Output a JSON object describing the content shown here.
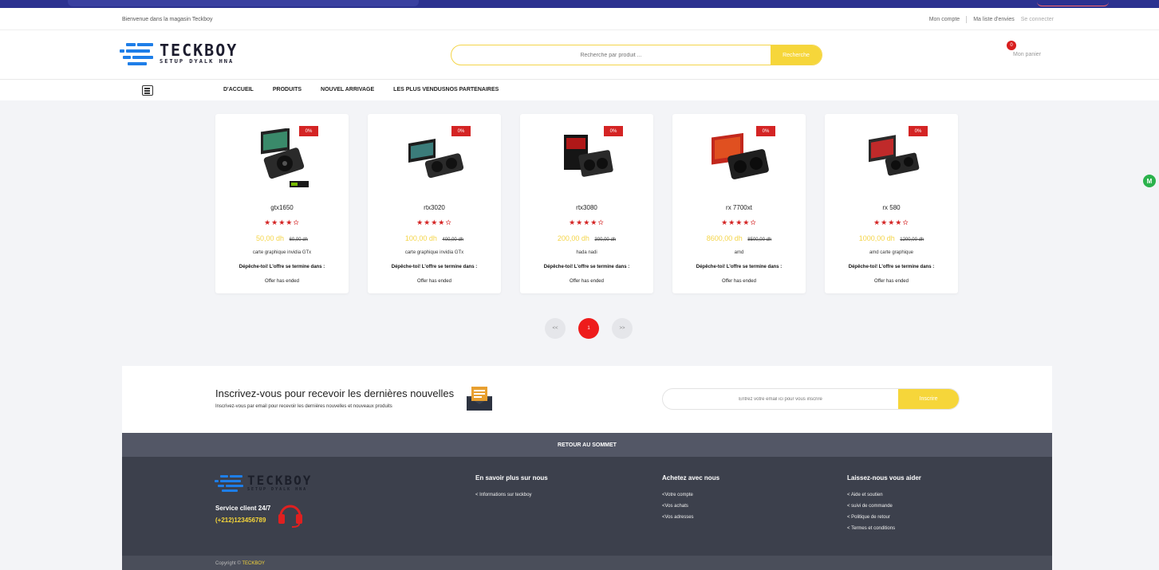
{
  "topbar": {
    "welcome": "Bienvenue dans la magasin Teckboy",
    "account": "Mon compte",
    "wishlist": "Ma liste d'envies",
    "logout": "Se connecter"
  },
  "brand": {
    "name": "TECKBOY",
    "tagline": "SETUP DYALK HNA",
    "accent": "#1e7ee8"
  },
  "search": {
    "placeholder": "Recherche par produit ...",
    "button": "Recherche"
  },
  "cart": {
    "count": "0",
    "label": "Mon panier"
  },
  "nav": {
    "items": [
      "D'ACCUEIL",
      "PRODUITS",
      "NOUVEL ARRIVAGE",
      "LES PLUS VENDUSNOS PARTENAIRES"
    ]
  },
  "products": [
    {
      "discount": "0%",
      "name": "gtx1650",
      "stars": "★★★★✫",
      "price": "50,00 dh",
      "old_price": "60,00 dh",
      "desc": "carte graphique invidia GTx",
      "timer": "Dépêche-toi! L'offre se termine dans :",
      "status": "Offer has ended"
    },
    {
      "discount": "0%",
      "name": "rtx3020",
      "stars": "★★★★✫",
      "price": "100,00 dh",
      "old_price": "400,00 dh",
      "desc": "carte graphique invidia GTx",
      "timer": "Dépêche-toi! L'offre se termine dans :",
      "status": "Offer has ended"
    },
    {
      "discount": "0%",
      "name": "rtx3080",
      "stars": "★★★★✫",
      "price": "200,00 dh",
      "old_price": "300,00 dh",
      "desc": "hada nadi",
      "timer": "Dépêche-toi! L'offre se termine dans :",
      "status": "Offer has ended"
    },
    {
      "discount": "0%",
      "name": "rx 7700xt",
      "stars": "★★★★✫",
      "price": "8600,00 dh",
      "old_price": "8500,00 dh",
      "desc": "amd",
      "timer": "Dépêche-toi! L'offre se termine dans :",
      "status": "Offer has ended"
    },
    {
      "discount": "0%",
      "name": "rx 580",
      "stars": "★★★★✫",
      "price": "1000,00 dh",
      "old_price": "1200,00 dh",
      "desc": "amd carte graphique",
      "timer": "Dépêche-toi! L'offre se termine dans :",
      "status": "Offer has ended"
    }
  ],
  "pager": {
    "prev": "<<",
    "current": "1",
    "next": ">>"
  },
  "newsletter": {
    "title": "Inscrivez-vous pour recevoir les dernières nouvelles",
    "subtitle": "Inscrivez-vous par email pour recevoir les dernières nouvelles et nouveaux produits",
    "placeholder": "Entrez votre email ici pour vous inscrire",
    "button": "Inscrire"
  },
  "back_to_top": "RETOUR AU SOMMET",
  "footer": {
    "service": "Service client 24/7",
    "phone": "(+212)123456789",
    "col1": {
      "title": "En savoir plus sur nous",
      "links": [
        "< Informations sur teckboy"
      ]
    },
    "col2": {
      "title": "Achetez avec nous",
      "links": [
        "<Votre compte",
        "<Vos achats",
        "<Vos adresses"
      ]
    },
    "col3": {
      "title": "Laissez-nous vous aider",
      "links": [
        "< Aide et soutien",
        "< suivi de commande",
        "< Politique de retour",
        "< Termes et conditions"
      ]
    },
    "copyright_prefix": "Copyright ©",
    "copyright_brand": "TECKBOY"
  },
  "side_badge": "M",
  "colors": {
    "yellow": "#f6d63a",
    "red": "#d42424",
    "footer": "#3c404c"
  }
}
